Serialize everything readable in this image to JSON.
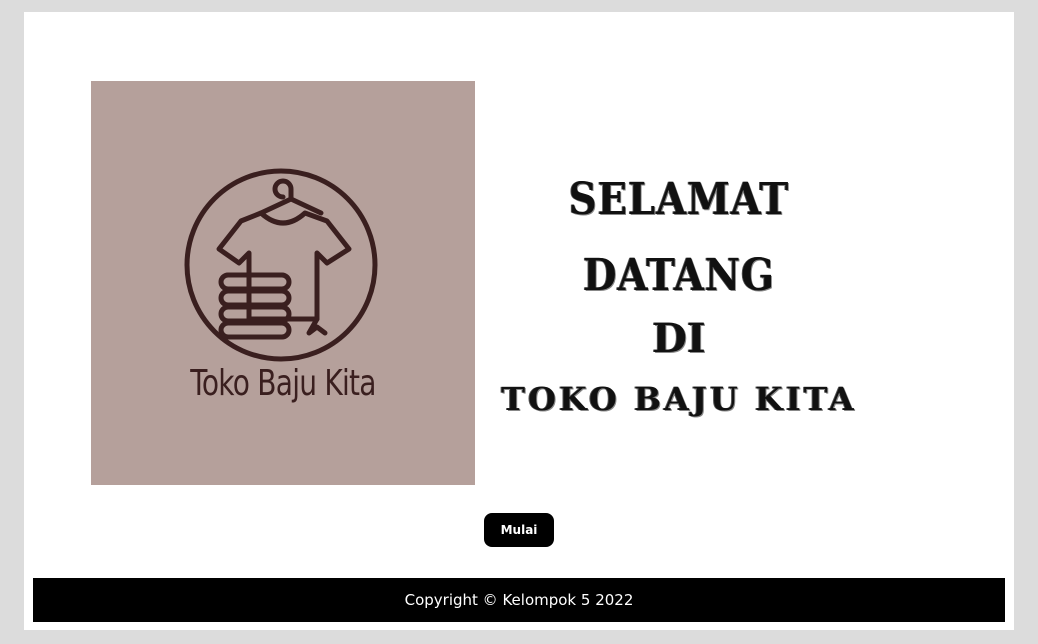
{
  "logo": {
    "text": "Toko Baju Kita",
    "background_color": "#b5a09b",
    "icon": "shirt-hanger-icon"
  },
  "welcome": {
    "line1": "SELAMAT DATANG",
    "line2": "DI",
    "line3": "TOKO BAJU KITA"
  },
  "actions": {
    "start_label": "Mulai"
  },
  "footer": {
    "copyright": "Copyright © Kelompok 5 2022"
  }
}
